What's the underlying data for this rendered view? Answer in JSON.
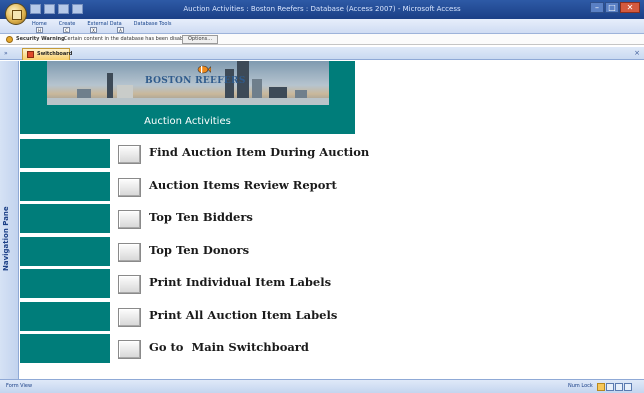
{
  "window": {
    "title": "Auction Activities : Boston Reefers : Database (Access 2007) - Microsoft Access",
    "min": "–",
    "max": "□",
    "close": "✕"
  },
  "ribbon": {
    "tabs": [
      "Home",
      "Create",
      "External Data",
      "Database Tools"
    ],
    "keytips": [
      "H",
      "C",
      "X",
      "A"
    ]
  },
  "security": {
    "label": "Security Warning",
    "message": "Certain content in the database has been disabled",
    "options_label": "Options..."
  },
  "document_tab": {
    "label": "Switchboard",
    "close": "×"
  },
  "nav_pane": {
    "label": "Navigation Pane",
    "shutter": "»"
  },
  "form": {
    "banner_title": "BOSTON REEFERS",
    "section_title": "Auction Activities",
    "menu_items": [
      "Find Auction Item During Auction",
      "Auction Items Review Report",
      "Top Ten Bidders",
      "Top Ten Donors",
      "Print Individual Item Labels",
      "Print All Auction Item Labels",
      "Go to  Main Switchboard"
    ]
  },
  "status": {
    "left": "Form View",
    "right": "Num Lock"
  },
  "colors": {
    "accent": "#007d7a",
    "ribbon": "#cfdcf3",
    "title_bar": "#1b3f86"
  }
}
